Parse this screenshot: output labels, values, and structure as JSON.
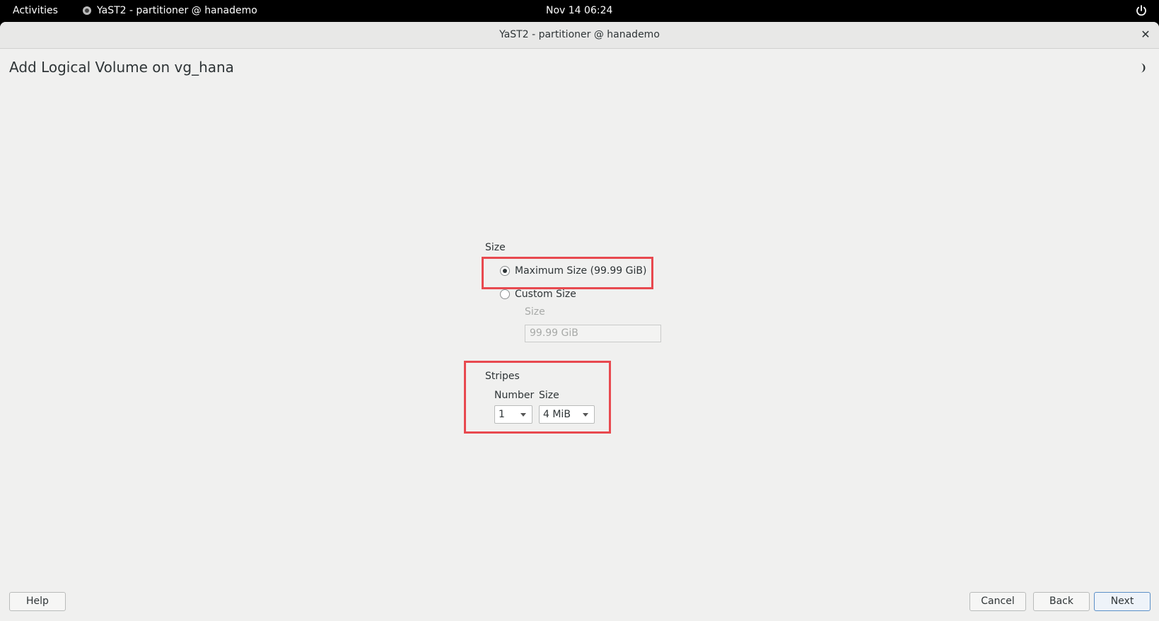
{
  "topbar": {
    "activities": "Activities",
    "app_name": "YaST2 - partitioner @ hanademo",
    "clock": "Nov 14  06:24"
  },
  "window": {
    "title": "YaST2 - partitioner @ hanademo",
    "close_symbol": "✕"
  },
  "dialog": {
    "heading": "Add Logical Volume on vg_hana",
    "size_group_label": "Size",
    "max_size_label": "Maximum Size (99.99 GiB)",
    "max_size_checked": true,
    "custom_size_label": "Custom Size",
    "custom_size_checked": false,
    "custom_size_field_label": "Size",
    "custom_size_value": "99.99 GiB",
    "stripes_label": "Stripes",
    "stripes_number_label": "Number",
    "stripes_size_label": "Size",
    "stripes_number_value": "1",
    "stripes_size_value": "4 MiB"
  },
  "buttons": {
    "help": "Help",
    "cancel": "Cancel",
    "back": "Back",
    "next": "Next"
  },
  "colors": {
    "highlight": "#e8494f",
    "background": "#f0f0ef"
  }
}
